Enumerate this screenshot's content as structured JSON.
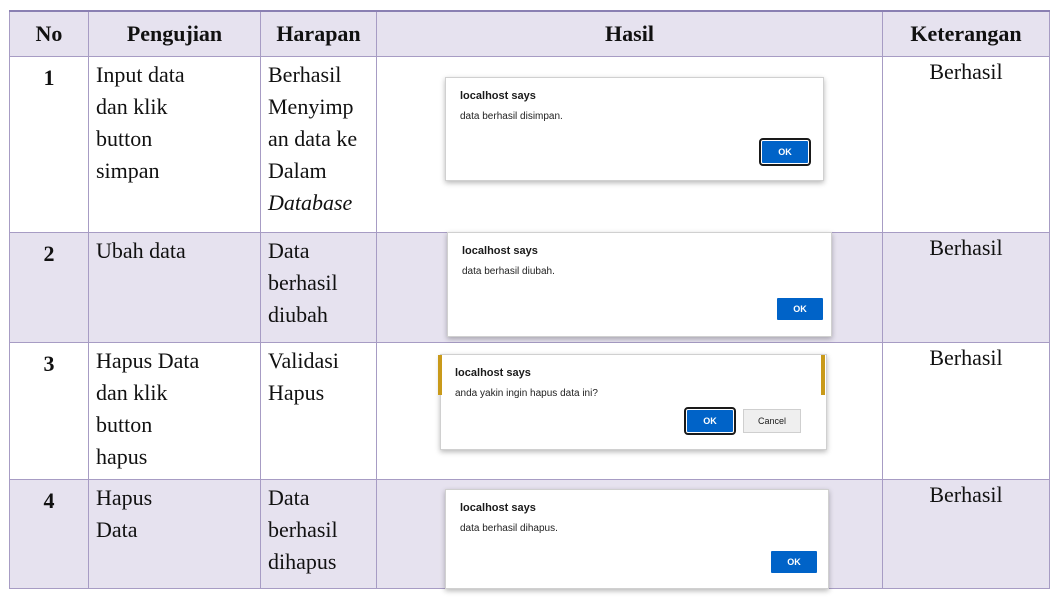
{
  "headers": {
    "no": "No",
    "pengujian": "Pengujian",
    "harapan": "Harapan",
    "hasil": "Hasil",
    "keterangan": "Keterangan"
  },
  "rows": [
    {
      "no": "1",
      "pengujian": [
        "Input data",
        "dan klik",
        "button",
        "simpan"
      ],
      "harapan": [
        "Berhasil",
        "Menyimp",
        "an data ke",
        "Dalam",
        "Database"
      ],
      "dialog": {
        "title": "localhost says",
        "message": "data berhasil disimpan.",
        "ok": "OK"
      },
      "keterangan": "Berhasil"
    },
    {
      "no": "2",
      "pengujian": [
        "Ubah data"
      ],
      "harapan": [
        "Data",
        "berhasil",
        "diubah"
      ],
      "dialog": {
        "title": "localhost says",
        "message": "data berhasil diubah.",
        "ok": "OK"
      },
      "keterangan": "Berhasil"
    },
    {
      "no": "3",
      "pengujian": [
        "Hapus Data",
        "dan klik",
        "button",
        "hapus"
      ],
      "harapan": [
        "Validasi",
        "Hapus"
      ],
      "dialog": {
        "title": "localhost says",
        "message": "anda yakin ingin hapus data ini?",
        "ok": "OK",
        "cancel": "Cancel"
      },
      "keterangan": "Berhasil"
    },
    {
      "no": "4",
      "pengujian": [
        "Hapus",
        "Data"
      ],
      "harapan": [
        "Data",
        "berhasil",
        "dihapus"
      ],
      "dialog": {
        "title": "localhost says",
        "message": "data berhasil dihapus.",
        "ok": "OK"
      },
      "keterangan": "Berhasil"
    }
  ]
}
